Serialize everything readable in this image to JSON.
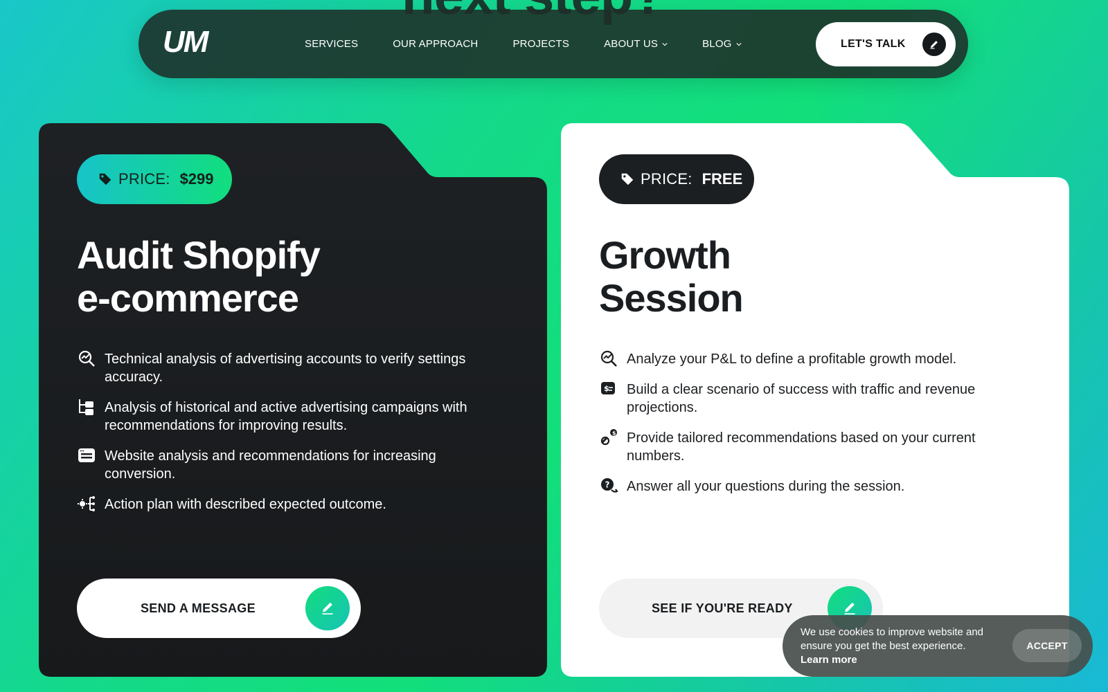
{
  "background_heading": "next step?",
  "nav": {
    "logo": "UM",
    "links": [
      {
        "label": "SERVICES",
        "has_dropdown": false
      },
      {
        "label": "OUR APPROACH",
        "has_dropdown": false
      },
      {
        "label": "PROJECTS",
        "has_dropdown": false
      },
      {
        "label": "ABOUT US",
        "has_dropdown": true
      },
      {
        "label": "BLOG",
        "has_dropdown": true
      }
    ],
    "cta_label": "LET'S TALK",
    "cta_icon": "pencil-icon"
  },
  "cards": [
    {
      "theme": "dark",
      "price_label": "PRICE:",
      "price_value": "$299",
      "price_icon": "price-tag-icon",
      "title_line1": "Audit Shopify",
      "title_line2": "e-commerce",
      "features": [
        {
          "icon": "analysis-magnifier-icon",
          "text": "Technical analysis of advertising accounts to verify settings accuracy."
        },
        {
          "icon": "hierarchy-folders-icon",
          "text": "Analysis of historical and active advertising campaigns with recommendations for improving results."
        },
        {
          "icon": "browser-window-icon",
          "text": "Website analysis and recommendations for increasing conversion."
        },
        {
          "icon": "action-plan-gear-icon",
          "text": "Action plan with described expected outcome."
        }
      ],
      "cta_label": "SEND A MESSAGE",
      "cta_icon": "pencil-icon"
    },
    {
      "theme": "light",
      "price_label": "PRICE:",
      "price_value": "FREE",
      "price_icon": "price-tag-icon",
      "title_line1": "Growth",
      "title_line2": "Session",
      "features": [
        {
          "icon": "analysis-magnifier-icon",
          "text": "Analyze your P&L to define a profitable growth model."
        },
        {
          "icon": "money-scenario-icon",
          "text": "Build a clear scenario of success with traffic and revenue projections."
        },
        {
          "icon": "recommendation-icon",
          "text": "Provide tailored recommendations based on your current numbers."
        },
        {
          "icon": "question-chat-icon",
          "text": "Answer all your questions during the session."
        }
      ],
      "cta_label": "SEE IF YOU'RE READY",
      "cta_icon": "pencil-icon"
    }
  ],
  "cookie": {
    "text": "We use cookies to improve website and ensure you get the best experience.",
    "learn_more": "Learn more",
    "accept_label": "ACCEPT"
  },
  "colors": {
    "accent_green": "#12de7d",
    "accent_teal": "#17c3c9",
    "dark_card": "#1c1f22",
    "light_card": "#ffffff"
  }
}
